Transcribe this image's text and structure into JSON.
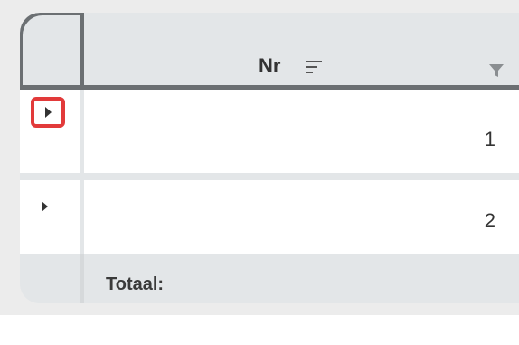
{
  "grid": {
    "columns": [
      {
        "label": "Nr",
        "sort_icon": "sort-lines-icon",
        "filter_icon": "filter-funnel-icon"
      }
    ],
    "rows": [
      {
        "nr": "1",
        "expander_icon": "caret-right-icon",
        "highlighted": true
      },
      {
        "nr": "2",
        "expander_icon": "caret-right-icon",
        "highlighted": false
      }
    ],
    "footer": {
      "label": "Totaal:"
    }
  },
  "colors": {
    "header_bg": "#e3e6e8",
    "grid_line": "#6b6f72",
    "highlight_border": "#e23a3a",
    "row_bg": "#ffffff"
  }
}
